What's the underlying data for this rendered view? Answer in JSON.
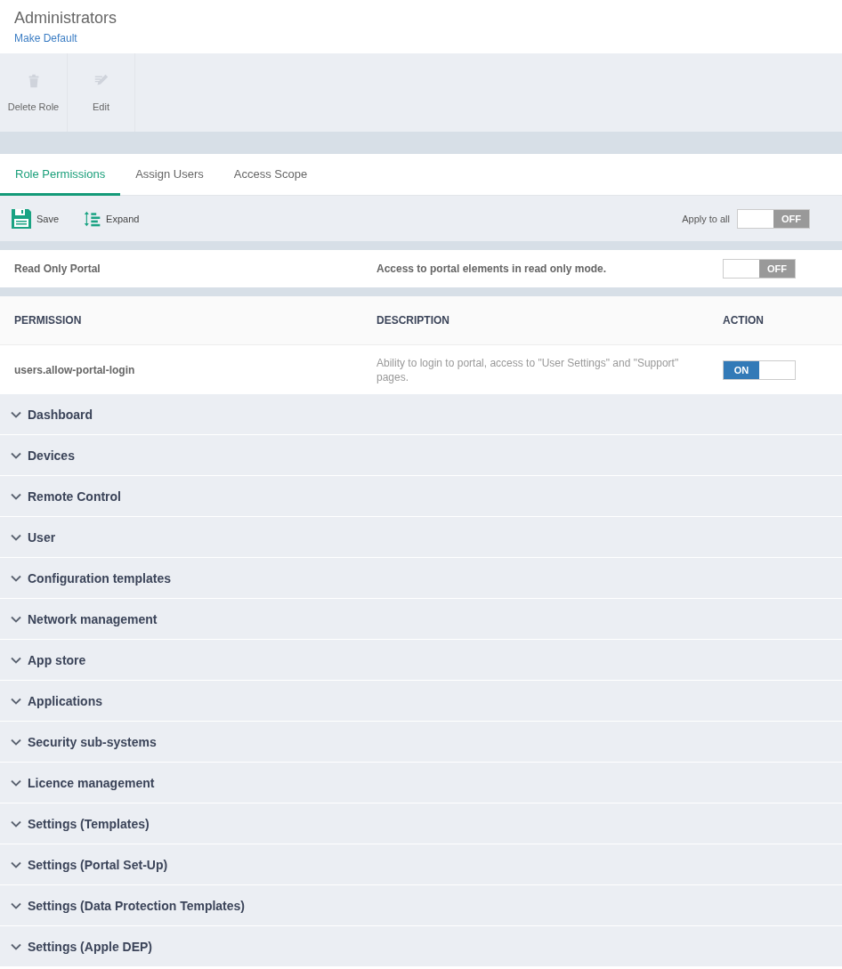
{
  "header": {
    "title": "Administrators",
    "link": "Make Default"
  },
  "toolbar": [
    {
      "label": "Delete Role",
      "kind": "trash",
      "disabled": true
    },
    {
      "label": "Edit",
      "kind": "edit",
      "disabled": true
    }
  ],
  "tabs": [
    {
      "label": "Role Permissions",
      "selected": true
    },
    {
      "label": "Assign Users",
      "selected": false
    },
    {
      "label": "Access Scope",
      "selected": false
    }
  ],
  "actions": [
    {
      "label": "Save",
      "kind": "save"
    },
    {
      "label": "Expand",
      "kind": "expand"
    }
  ],
  "apply_all": {
    "label": "Apply to all",
    "on": false,
    "text": "OFF"
  },
  "read_only": {
    "name": "Read Only Portal",
    "description": "Access to portal elements in read only mode.",
    "on": false,
    "text": "OFF"
  },
  "table": {
    "columns": [
      "PERMISSION",
      "DESCRIPTION",
      "ACTION"
    ],
    "rows": [
      {
        "permission": "users.allow-portal-login",
        "description": "Ability to login to portal, access to \"User Settings\" and \"Support\" pages.",
        "on": true,
        "text": "ON"
      }
    ]
  },
  "groups": [
    {
      "label": "Dashboard",
      "expanded": false
    },
    {
      "label": "Devices",
      "expanded": false
    },
    {
      "label": "Remote Control",
      "expanded": false
    },
    {
      "label": "User",
      "expanded": false
    },
    {
      "label": "Configuration templates",
      "expanded": false
    },
    {
      "label": "Network management",
      "expanded": false
    },
    {
      "label": "App store",
      "expanded": false
    },
    {
      "label": "Applications",
      "expanded": false
    },
    {
      "label": "Security sub-systems",
      "expanded": false
    },
    {
      "label": "Licence management",
      "expanded": false
    },
    {
      "label": "Settings (Templates)",
      "expanded": false
    },
    {
      "label": "Settings (Portal Set-Up)",
      "expanded": false
    },
    {
      "label": "Settings (Data Protection Templates)",
      "expanded": false
    },
    {
      "label": "Settings (Apple DEP)",
      "expanded": false
    }
  ]
}
